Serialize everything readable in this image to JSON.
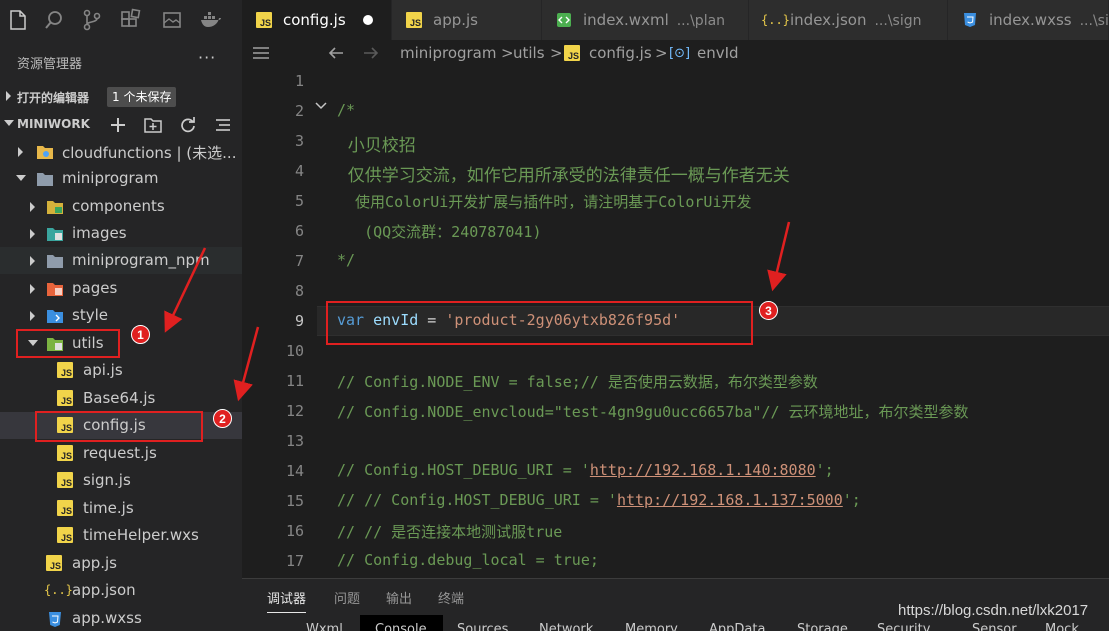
{
  "sidebar": {
    "title": "资源管理器",
    "more": "···",
    "open_editors": {
      "label": "打开的编辑器",
      "badge": "1 个未保存"
    },
    "project": {
      "label": "MINIWORK"
    },
    "tree": [
      {
        "name": "cloudfunctions | (未选...",
        "icon": "folder-cloud-icon"
      },
      {
        "name": "miniprogram",
        "icon": "folder-icon"
      },
      {
        "name": "components",
        "icon": "folder-components-icon"
      },
      {
        "name": "images",
        "icon": "folder-images-icon"
      },
      {
        "name": "miniprogram_npm",
        "icon": "folder-icon"
      },
      {
        "name": "pages",
        "icon": "folder-pages-icon"
      },
      {
        "name": "style",
        "icon": "folder-style-icon"
      },
      {
        "name": "utils",
        "icon": "folder-utils-icon"
      },
      {
        "name": "api.js",
        "icon": "js-file-icon"
      },
      {
        "name": "Base64.js",
        "icon": "js-file-icon"
      },
      {
        "name": "config.js",
        "icon": "js-file-icon"
      },
      {
        "name": "request.js",
        "icon": "js-file-icon"
      },
      {
        "name": "sign.js",
        "icon": "js-file-icon"
      },
      {
        "name": "time.js",
        "icon": "js-file-icon"
      },
      {
        "name": "timeHelper.wxs",
        "icon": "wxs-file-icon"
      },
      {
        "name": "app.js",
        "icon": "js-file-icon"
      },
      {
        "name": "app.json",
        "icon": "json-file-icon"
      },
      {
        "name": "app.wxss",
        "icon": "css-file-icon"
      }
    ]
  },
  "tabs": [
    {
      "name": "config.js",
      "path": "",
      "icon_label": "JS"
    },
    {
      "name": "app.js",
      "path": "",
      "icon_label": "JS"
    },
    {
      "name": "index.wxml",
      "path": "...\\plan",
      "icon_label": "<>"
    },
    {
      "name": "index.json",
      "path": "...\\sign",
      "icon_label": "{..}"
    },
    {
      "name": "index.wxss",
      "path": "...\\sign",
      "icon_label": "3"
    }
  ],
  "breadcrumb": [
    "miniprogram",
    ">",
    "utils",
    ">",
    "config.js",
    ">",
    "envId"
  ],
  "editor": {
    "line_numbers": [
      "1",
      "2",
      "3",
      "4",
      "5",
      "6",
      "7",
      "8",
      "9",
      "10",
      "11",
      "12",
      "13",
      "14",
      "15",
      "16",
      "17"
    ],
    "comment_open": "/*",
    "comment_l3": "  小贝校招",
    "comment_l4": "  仅供学习交流，如作它用所承受的法律责任一概与作者无关",
    "comment_l5": "  使用ColorUi开发扩展与插件时，请注明基于ColorUi开发",
    "comment_l6": "   (QQ交流群：240787041)",
    "comment_close": "*/",
    "l9_kw": "var",
    "l9_var": "envId",
    "l9_eq": " = ",
    "l9_str": "'product-2gy06ytxb826f95d'",
    "l11": "// Config.NODE_ENV = false;// 是否使用云数据，布尔类型参数",
    "l12": "// Config.NODE_envcloud=\"test-4gn9gu0ucc6657ba\"// 云环境地址，布尔类型参数",
    "l14_pre": "// Config.HOST_DEBUG_URI = '",
    "l14_url": "http://192.168.1.140:8080",
    "l14_post": "';",
    "l15_pre": "// // Config.HOST_DEBUG_URI = '",
    "l15_url": "http://192.168.1.137:5000",
    "l15_post": "';",
    "l16": "// // 是否连接本地测试服true",
    "l17": "// Config.debug_local = true;"
  },
  "panel": {
    "tabs": [
      "调试器",
      "问题",
      "输出",
      "终端"
    ],
    "sub_tabs": [
      "Wxml",
      "Console",
      "Sources",
      "Network",
      "Memory",
      "AppData",
      "Storage",
      "Security",
      "Sensor",
      "Mock"
    ]
  },
  "annotations": [
    "1",
    "2",
    "3"
  ],
  "watermark": "https://blog.csdn.net/lxk2017",
  "colors": {
    "annotation": "#e02020",
    "js_icon": "#f1d44a",
    "comment": "#6a9955",
    "keyword": "#569cd6",
    "string": "#ce9178"
  }
}
